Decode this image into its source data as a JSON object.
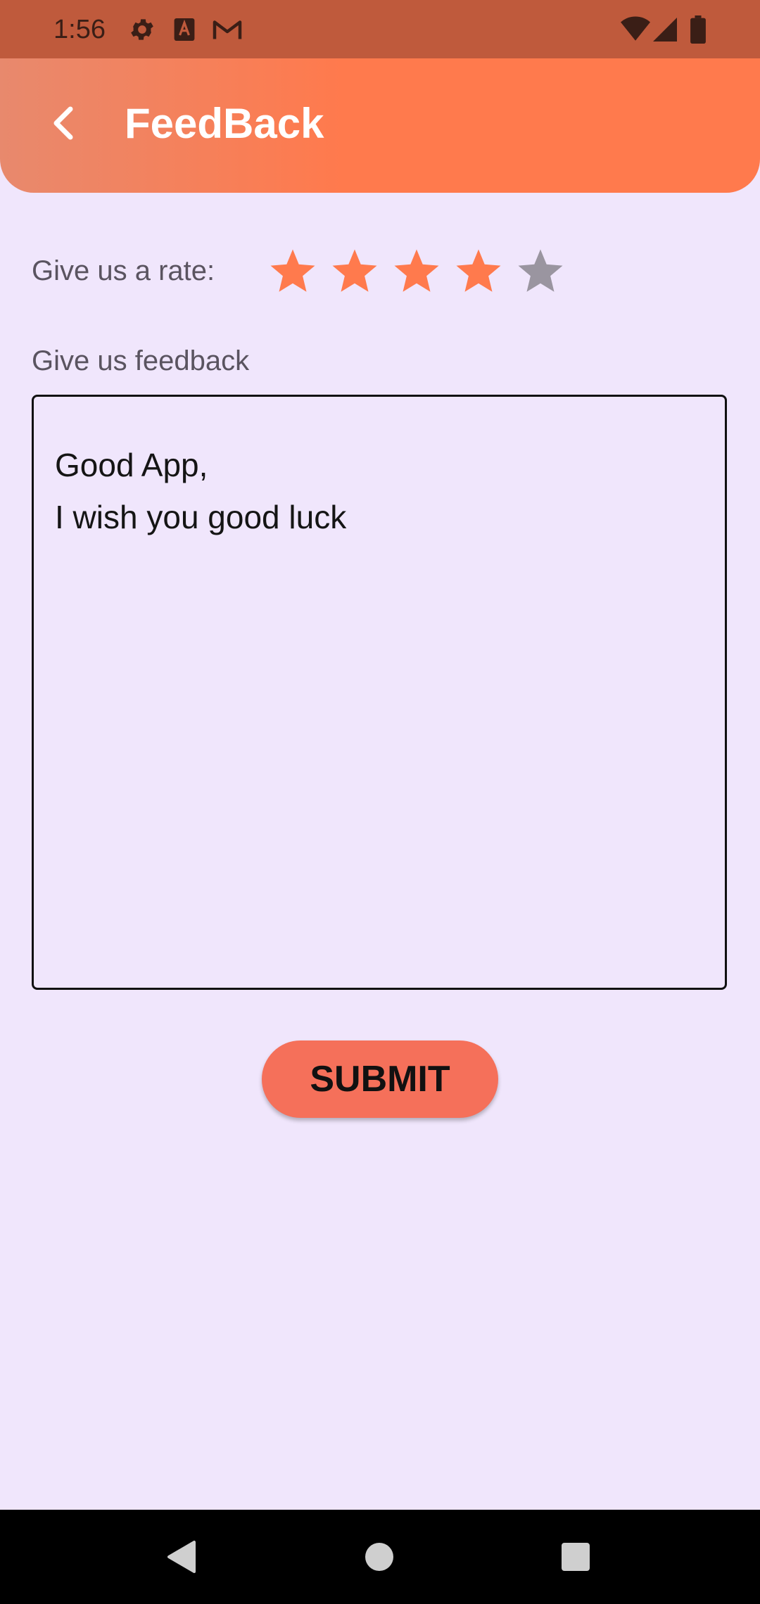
{
  "status_bar": {
    "time": "1:56",
    "icons": [
      "settings-icon",
      "a-box-icon",
      "gmail-icon",
      "wifi-icon",
      "signal-icon",
      "battery-icon"
    ],
    "color": "#bf5a3c"
  },
  "app_bar": {
    "title": "FeedBack",
    "back_icon": "chevron-left-icon",
    "gradient_start": "#e8896d",
    "gradient_end": "#ff7a4d"
  },
  "rating": {
    "label": "Give us a rate:",
    "value": 4,
    "max": 5,
    "active_color": "#ff7a4d",
    "inactive_color": "#9a95a0"
  },
  "feedback": {
    "label": "Give us feedback",
    "lines": [
      "Good App,",
      "I wish you good luck"
    ]
  },
  "submit": {
    "label": "SUBMIT",
    "color": "#f5705a"
  },
  "nav_bar": {
    "icons": [
      "back-triangle-icon",
      "home-circle-icon",
      "recents-square-icon"
    ]
  }
}
